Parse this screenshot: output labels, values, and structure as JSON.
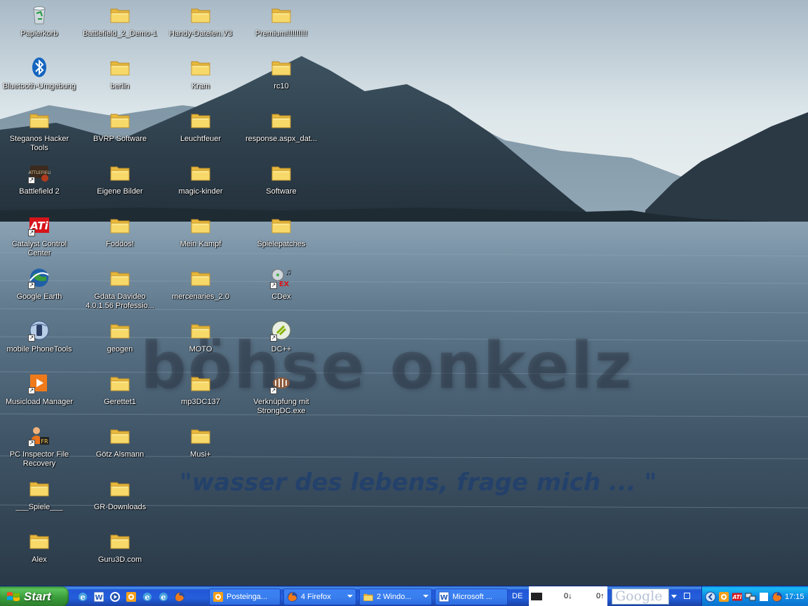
{
  "desktop": {
    "watermark_main": "böhse onkelz",
    "watermark_quote": "\"wasser des lebens, frage mich ... \"",
    "icons": [
      {
        "label": "Papierkorb",
        "icon": "recycle-bin-icon",
        "shortcut": false
      },
      {
        "label": "Bluetooth-Umgebung",
        "icon": "bluetooth-icon",
        "shortcut": false
      },
      {
        "label": "Steganos Hacker Tools",
        "icon": "folder-icon",
        "shortcut": false
      },
      {
        "label": "Battlefield 2",
        "icon": "battlefield-icon",
        "shortcut": true
      },
      {
        "label": "Catalyst Control Center",
        "icon": "ati-icon",
        "shortcut": true
      },
      {
        "label": "Google Earth",
        "icon": "google-earth-icon",
        "shortcut": true
      },
      {
        "label": "mobile PhoneTools",
        "icon": "phonetools-icon",
        "shortcut": true
      },
      {
        "label": "Musicload Manager",
        "icon": "musicload-icon",
        "shortcut": true
      },
      {
        "label": "PC Inspector File Recovery",
        "icon": "file-recovery-icon",
        "shortcut": true
      },
      {
        "label": "___Spiele___",
        "icon": "folder-icon",
        "shortcut": false
      },
      {
        "label": "Alex",
        "icon": "folder-icon",
        "shortcut": false
      },
      {
        "label": "Battlefield_2_Demo-1",
        "icon": "folder-icon",
        "shortcut": false
      },
      {
        "label": "berlin",
        "icon": "folder-icon",
        "shortcut": false
      },
      {
        "label": "BVRP Software",
        "icon": "folder-icon",
        "shortcut": false
      },
      {
        "label": "Eigene Bilder",
        "icon": "folder-icon",
        "shortcut": false
      },
      {
        "label": "Foddos!",
        "icon": "folder-icon",
        "shortcut": false
      },
      {
        "label": "Gdata Davideo 4.0.1.56 Professio...",
        "icon": "folder-icon",
        "shortcut": false
      },
      {
        "label": "geogen",
        "icon": "folder-icon",
        "shortcut": false
      },
      {
        "label": "Gerettet1",
        "icon": "folder-icon",
        "shortcut": false
      },
      {
        "label": "Götz Alsmann",
        "icon": "folder-icon",
        "shortcut": false
      },
      {
        "label": "GR-Downloads",
        "icon": "folder-icon",
        "shortcut": false
      },
      {
        "label": "Guru3D.com",
        "icon": "folder-icon",
        "shortcut": false
      },
      {
        "label": "Handy-Dateien.V3",
        "icon": "folder-icon",
        "shortcut": false
      },
      {
        "label": "Kram",
        "icon": "folder-icon",
        "shortcut": false
      },
      {
        "label": "Leuchtfeuer",
        "icon": "folder-icon",
        "shortcut": false
      },
      {
        "label": "magic-kinder",
        "icon": "folder-icon",
        "shortcut": false
      },
      {
        "label": "Mein Kampf",
        "icon": "folder-icon",
        "shortcut": false
      },
      {
        "label": "mercenaries_2.0",
        "icon": "folder-icon",
        "shortcut": false
      },
      {
        "label": "MOTO",
        "icon": "folder-icon",
        "shortcut": false
      },
      {
        "label": "mp3DC137",
        "icon": "folder-icon",
        "shortcut": false
      },
      {
        "label": "Musi+",
        "icon": "folder-icon",
        "shortcut": false
      },
      {
        "label": "Premium!!!!!!!!!!",
        "icon": "folder-icon",
        "shortcut": false
      },
      {
        "label": "rc10",
        "icon": "folder-icon",
        "shortcut": false
      },
      {
        "label": "response.aspx_dat...",
        "icon": "folder-icon",
        "shortcut": false
      },
      {
        "label": "Software",
        "icon": "folder-icon",
        "shortcut": false
      },
      {
        "label": "Spielepatches",
        "icon": "folder-icon",
        "shortcut": false
      },
      {
        "label": "CDex",
        "icon": "cdex-icon",
        "shortcut": true
      },
      {
        "label": "DC++",
        "icon": "dcpp-icon",
        "shortcut": true
      },
      {
        "label": "Verknüpfung mit StrongDC.exe",
        "icon": "strongdc-icon",
        "shortcut": true
      }
    ]
  },
  "taskbar": {
    "start_label": "Start",
    "quicklaunch": [
      "ie-icon",
      "word-icon",
      "media-player-icon",
      "outlook-icon",
      "ie-icon",
      "ie-icon",
      "firefox-icon"
    ],
    "tasks": [
      {
        "label": "Posteinga...",
        "icon": "outlook-icon",
        "has_arrow": false
      },
      {
        "label": "4 Firefox",
        "icon": "firefox-icon",
        "has_arrow": true
      },
      {
        "label": "2 Windo...",
        "icon": "folder-icon",
        "has_arrow": true
      },
      {
        "label": "Microsoft ...",
        "icon": "word-icon",
        "has_arrow": false
      }
    ],
    "language": "DE",
    "meter_down": "0↓",
    "meter_up": "0↑",
    "google_toolbar": "Google",
    "tray_icons": [
      "back-arrow-icon",
      "outlook-icon",
      "ati-icon",
      "network-icon",
      "white-box-icon",
      "firefox-icon"
    ],
    "clock": "17:15"
  },
  "colors": {
    "taskbar_blue": "#245edb",
    "start_green": "#3a9d3a",
    "tray_blue": "#0f8be3",
    "folder_yellow": "#f5d35f"
  }
}
